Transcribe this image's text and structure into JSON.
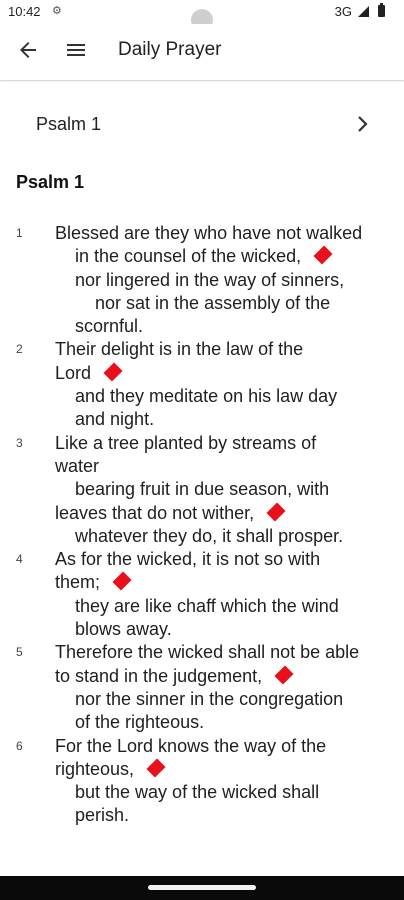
{
  "status": {
    "time": "10:42",
    "network": "3G",
    "small_icon": "notification-icon"
  },
  "appbar": {
    "title": "Daily Prayer",
    "back_icon": "arrow-left-icon",
    "menu_icon": "hamburger-menu-icon"
  },
  "nav_item": {
    "label": "Psalm 1",
    "chevron_icon": "chevron-right-icon"
  },
  "content": {
    "heading": "Psalm 1",
    "verses": [
      {
        "number": "1",
        "lines": [
          {
            "text": "Blessed are they who have not walked",
            "indent": 1,
            "mark": false
          },
          {
            "text": "in the counsel of the wicked,",
            "indent": 2,
            "mark": true
          },
          {
            "text": "nor lingered in the way of sinners,",
            "indent": 2,
            "mark": false
          },
          {
            "text": "nor sat in the assembly of the",
            "indent": 3,
            "mark": false
          },
          {
            "text": "scornful.",
            "indent": 2,
            "mark": false
          }
        ]
      },
      {
        "number": "2",
        "lines": [
          {
            "text": "Their delight is in the law of the",
            "indent": 1,
            "mark": false
          },
          {
            "text": "Lord",
            "indent": 1,
            "mark": true
          },
          {
            "text": "and they meditate on his law day",
            "indent": 2,
            "mark": false
          },
          {
            "text": "and night.",
            "indent": 2,
            "mark": false
          }
        ]
      },
      {
        "number": "3",
        "lines": [
          {
            "text": "Like a tree planted by streams of",
            "indent": 1,
            "mark": false
          },
          {
            "text": "water",
            "indent": 1,
            "mark": false
          },
          {
            "text": "bearing fruit in due season, with",
            "indent": 2,
            "mark": false
          },
          {
            "text": "leaves that do not wither,",
            "indent": 1,
            "mark": true
          },
          {
            "text": "whatever they do, it shall prosper.",
            "indent": 2,
            "mark": false
          }
        ]
      },
      {
        "number": "4",
        "lines": [
          {
            "text": "As for the wicked, it is not so with",
            "indent": 1,
            "mark": false
          },
          {
            "text": "them;",
            "indent": 1,
            "mark": true
          },
          {
            "text": "they are like chaff which the wind",
            "indent": 2,
            "mark": false
          },
          {
            "text": "blows away.",
            "indent": 2,
            "mark": false
          }
        ]
      },
      {
        "number": "5",
        "lines": [
          {
            "text": "Therefore the wicked shall not be able",
            "indent": 1,
            "mark": false
          },
          {
            "text": "to stand in the judgement,",
            "indent": 1,
            "mark": true
          },
          {
            "text": "nor the sinner in the congregation",
            "indent": 2,
            "mark": false
          },
          {
            "text": "of the righteous.",
            "indent": 2,
            "mark": false
          }
        ]
      },
      {
        "number": "6",
        "lines": [
          {
            "text": "For the Lord knows the way of the",
            "indent": 1,
            "mark": false
          },
          {
            "text": "righteous,",
            "indent": 1,
            "mark": true
          },
          {
            "text": "but the way of the wicked shall",
            "indent": 2,
            "mark": false
          },
          {
            "text": "perish.",
            "indent": 2,
            "mark": false
          }
        ]
      }
    ]
  },
  "colors": {
    "marker": "#e8101a",
    "navbar": "#0a0a0a"
  }
}
